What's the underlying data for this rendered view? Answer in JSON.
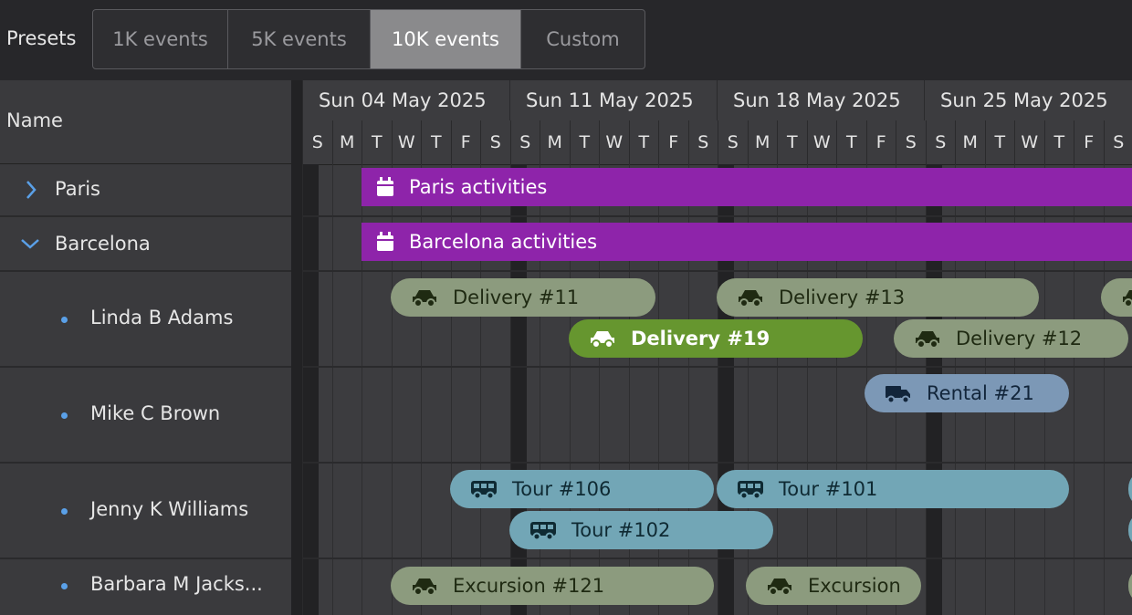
{
  "toolbar": {
    "label": "Presets",
    "presets": [
      "1K events",
      "5K events",
      "10K events",
      "Custom"
    ],
    "active_preset": "10K events"
  },
  "grid": {
    "name_header": "Name",
    "weeks": [
      "Sun 04 May 2025",
      "Sun 11 May 2025",
      "Sun 18 May 2025",
      "Sun 25 May 2025"
    ],
    "days": [
      "S",
      "M",
      "T",
      "W",
      "T",
      "F",
      "S",
      "S",
      "M",
      "T",
      "W",
      "T",
      "F",
      "S",
      "S",
      "M",
      "T",
      "W",
      "T",
      "F",
      "S",
      "S",
      "M",
      "T",
      "W",
      "T",
      "F",
      "S"
    ]
  },
  "resources": {
    "paris": "Paris",
    "barcelona": "Barcelona",
    "linda": "Linda B Adams",
    "mike": "Mike C Brown",
    "jenny": "Jenny K Williams",
    "barbara": "Barbara M Jacks..."
  },
  "events": {
    "paris": "Paris activities",
    "barcelona": "Barcelona activities",
    "d11": "Delivery #11",
    "d13": "Delivery #13",
    "d19": "Delivery #19",
    "d12": "Delivery #12",
    "r21": "Rental #21",
    "t106": "Tour #106",
    "t101": "Tour #101",
    "t102": "Tour #102",
    "e121": "Excursion #121",
    "e2": "Excursion"
  },
  "colors": {
    "accent_purple": "#8e24aa",
    "selected_green": "#66962f",
    "delivery_olive": "#8c9b7e",
    "rental_blue": "#7c98b6",
    "tour_teal": "#72a6b6",
    "tree_blue": "#5aa0e8"
  },
  "icons": {
    "group": "calendar-icon",
    "delivery": "car-icon",
    "rental": "truck-icon",
    "tour": "bus-icon",
    "excursion": "car-icon"
  }
}
